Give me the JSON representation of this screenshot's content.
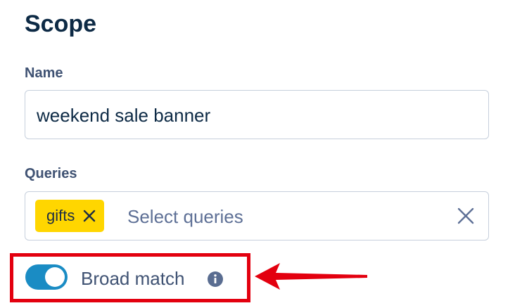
{
  "section": {
    "title": "Scope"
  },
  "name_field": {
    "label": "Name",
    "value": "weekend sale banner"
  },
  "queries_field": {
    "label": "Queries",
    "chips": [
      "gifts"
    ],
    "placeholder": "Select queries"
  },
  "broad_match": {
    "label": "Broad match",
    "enabled": true
  },
  "icons": {
    "chip_remove": "close-icon",
    "clear": "close-icon",
    "info": "info-icon"
  },
  "colors": {
    "title": "#0d2a45",
    "label": "#3f5273",
    "chip_background": "#ffd600",
    "toggle_on": "#1a8cc4",
    "annotation_red": "#e3000f"
  }
}
